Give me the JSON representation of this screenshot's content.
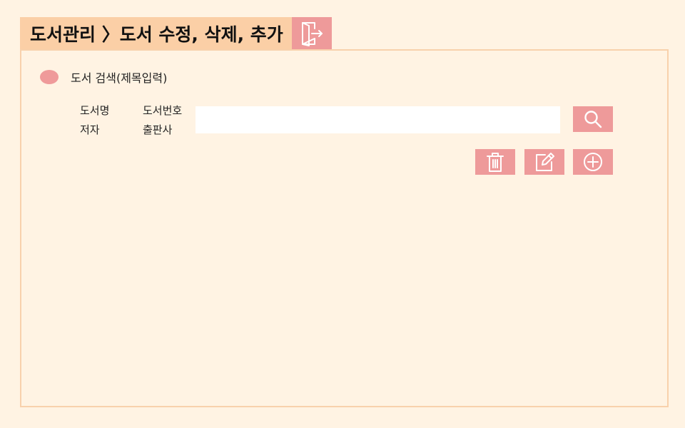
{
  "header": {
    "title": "도서관리 〉도서 수정, 삭제, 추가",
    "exit_icon": "exit-door-icon"
  },
  "search": {
    "heading": "도서 검색(제목입력)",
    "field_options": [
      "도서명",
      "도서번호",
      "저자",
      "출판사"
    ],
    "input_value": "",
    "search_icon": "search-icon"
  },
  "actions": {
    "icons": [
      "trash-icon",
      "edit-icon",
      "add-circle-icon"
    ]
  },
  "colors": {
    "background": "#fff3e3",
    "title_bg": "#fbcfa6",
    "accent": "#ee9a9a",
    "panel_border": "#f8d1ac"
  }
}
